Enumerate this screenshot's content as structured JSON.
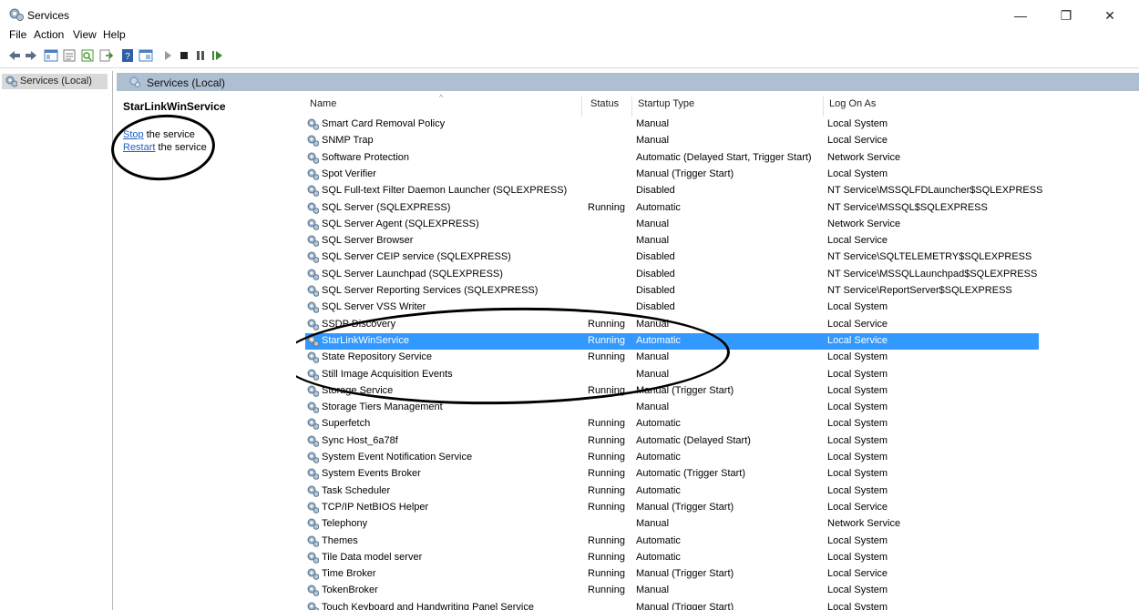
{
  "window": {
    "title": "Services",
    "controls": {
      "minimize": "—",
      "maximize": "❐",
      "close": "✕"
    }
  },
  "menu": [
    "File",
    "Action",
    "View",
    "Help"
  ],
  "toolbar": [
    "back-icon",
    "forward-icon",
    "show-hide-tree-icon",
    "properties-icon",
    "refresh-icon",
    "export-icon",
    "help-icon",
    "console-icon",
    "start-icon",
    "stop-icon",
    "pause-icon",
    "resume-icon"
  ],
  "tree": {
    "root_label": "Services (Local)"
  },
  "pane": {
    "header_label": "Services (Local)"
  },
  "extended": {
    "service_name": "StarLinkWinService",
    "stop_link": "Stop",
    "stop_rest": "the service",
    "restart_link": "Restart",
    "restart_rest": "the service"
  },
  "columns": {
    "name": "Name",
    "status": "Status",
    "startup": "Startup Type",
    "logon": "Log On As"
  },
  "services": [
    {
      "name": "Smart Card Removal Policy",
      "status": "",
      "startup": "Manual",
      "logon": "Local System"
    },
    {
      "name": "SNMP Trap",
      "status": "",
      "startup": "Manual",
      "logon": "Local Service"
    },
    {
      "name": "Software Protection",
      "status": "",
      "startup": "Automatic (Delayed Start, Trigger Start)",
      "logon": "Network Service"
    },
    {
      "name": "Spot Verifier",
      "status": "",
      "startup": "Manual (Trigger Start)",
      "logon": "Local System"
    },
    {
      "name": "SQL Full-text Filter Daemon Launcher (SQLEXPRESS)",
      "status": "",
      "startup": "Disabled",
      "logon": "NT Service\\MSSQLFDLauncher$SQLEXPRESS"
    },
    {
      "name": "SQL Server (SQLEXPRESS)",
      "status": "Running",
      "startup": "Automatic",
      "logon": "NT Service\\MSSQL$SQLEXPRESS"
    },
    {
      "name": "SQL Server Agent (SQLEXPRESS)",
      "status": "",
      "startup": "Manual",
      "logon": "Network Service"
    },
    {
      "name": "SQL Server Browser",
      "status": "",
      "startup": "Manual",
      "logon": "Local Service"
    },
    {
      "name": "SQL Server CEIP service (SQLEXPRESS)",
      "status": "",
      "startup": "Disabled",
      "logon": "NT Service\\SQLTELEMETRY$SQLEXPRESS"
    },
    {
      "name": "SQL Server Launchpad (SQLEXPRESS)",
      "status": "",
      "startup": "Disabled",
      "logon": "NT Service\\MSSQLLaunchpad$SQLEXPRESS"
    },
    {
      "name": "SQL Server Reporting Services (SQLEXPRESS)",
      "status": "",
      "startup": "Disabled",
      "logon": "NT Service\\ReportServer$SQLEXPRESS"
    },
    {
      "name": "SQL Server VSS Writer",
      "status": "",
      "startup": "Disabled",
      "logon": "Local System"
    },
    {
      "name": "SSDP Discovery",
      "status": "Running",
      "startup": "Manual",
      "logon": "Local Service"
    },
    {
      "name": "StarLinkWinService",
      "status": "Running",
      "startup": "Automatic",
      "logon": "Local Service",
      "selected": true
    },
    {
      "name": "State Repository Service",
      "status": "Running",
      "startup": "Manual",
      "logon": "Local System"
    },
    {
      "name": "Still Image Acquisition Events",
      "status": "",
      "startup": "Manual",
      "logon": "Local System"
    },
    {
      "name": "Storage Service",
      "status": "Running",
      "startup": "Manual (Trigger Start)",
      "logon": "Local System"
    },
    {
      "name": "Storage Tiers Management",
      "status": "",
      "startup": "Manual",
      "logon": "Local System"
    },
    {
      "name": "Superfetch",
      "status": "Running",
      "startup": "Automatic",
      "logon": "Local System"
    },
    {
      "name": "Sync Host_6a78f",
      "status": "Running",
      "startup": "Automatic (Delayed Start)",
      "logon": "Local System"
    },
    {
      "name": "System Event Notification Service",
      "status": "Running",
      "startup": "Automatic",
      "logon": "Local System"
    },
    {
      "name": "System Events Broker",
      "status": "Running",
      "startup": "Automatic (Trigger Start)",
      "logon": "Local System"
    },
    {
      "name": "Task Scheduler",
      "status": "Running",
      "startup": "Automatic",
      "logon": "Local System"
    },
    {
      "name": "TCP/IP NetBIOS Helper",
      "status": "Running",
      "startup": "Manual (Trigger Start)",
      "logon": "Local Service"
    },
    {
      "name": "Telephony",
      "status": "",
      "startup": "Manual",
      "logon": "Network Service"
    },
    {
      "name": "Themes",
      "status": "Running",
      "startup": "Automatic",
      "logon": "Local System"
    },
    {
      "name": "Tile Data model server",
      "status": "Running",
      "startup": "Automatic",
      "logon": "Local System"
    },
    {
      "name": "Time Broker",
      "status": "Running",
      "startup": "Manual (Trigger Start)",
      "logon": "Local Service"
    },
    {
      "name": "TokenBroker",
      "status": "Running",
      "startup": "Manual",
      "logon": "Local System"
    },
    {
      "name": "Touch Keyboard and Handwriting Panel Service",
      "status": "",
      "startup": "Manual (Trigger Start)",
      "logon": "Local System"
    }
  ],
  "colors": {
    "selection": "#3399ff",
    "pane_header": "#aebfd2",
    "link": "#1f5fbf"
  }
}
